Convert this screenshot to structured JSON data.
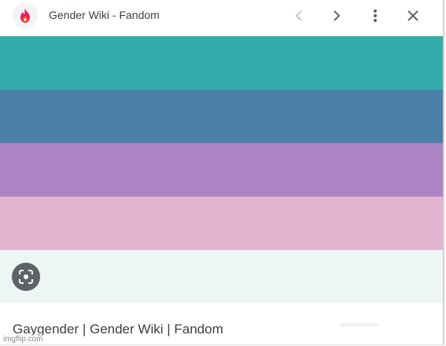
{
  "header": {
    "site_title": "Gender Wiki - Fandom",
    "icons": [
      "fandom-flame-icon",
      "chevron-left-icon",
      "chevron-right-icon",
      "more-vert-icon",
      "close-icon"
    ]
  },
  "preview": {
    "stripe_colors": [
      "#33adab",
      "#4a7fa8",
      "#ad84c4",
      "#e2b4cf"
    ],
    "footer_color": "#eef6f5",
    "lens_icon": "lens-icon"
  },
  "result": {
    "title": "Gaygender | Gender Wiki | Fandom"
  },
  "watermark": "imgflip.com",
  "colors": {
    "accent": "#e91e63",
    "flame": "#ff5a00",
    "text": "#3c4043",
    "icon": "#5f6368"
  }
}
